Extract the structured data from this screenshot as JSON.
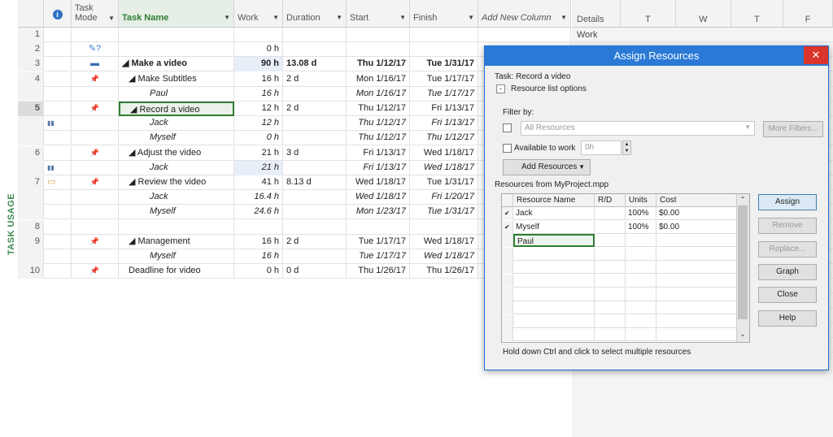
{
  "side_label": "TASK USAGE",
  "columns": {
    "info_icon": "i",
    "task_mode": "Task Mode",
    "task_name": "Task Name",
    "work": "Work",
    "duration": "Duration",
    "start": "Start",
    "finish": "Finish",
    "add_new": "Add New Column"
  },
  "rows": [
    {
      "num": "1",
      "mode": "",
      "name": "",
      "work": "",
      "duration": "",
      "start": "",
      "finish": ""
    },
    {
      "num": "2",
      "mode": "?",
      "name": "",
      "work": "0 h",
      "duration": "",
      "start": "",
      "finish": ""
    },
    {
      "num": "3",
      "mode": "summary",
      "name": "◢ Make a video",
      "work": "90 h",
      "duration": "13.08 d",
      "start": "Thu 1/12/17",
      "finish": "Tue 1/31/17"
    },
    {
      "num": "4",
      "mode": "pin",
      "name": "◢ Make Subtitles",
      "work": "16 h",
      "duration": "2 d",
      "start": "Mon 1/16/17",
      "finish": "Tue 1/17/17"
    },
    {
      "num": "",
      "mode": "",
      "name": "Paul",
      "work": "16 h",
      "duration": "",
      "start": "Mon 1/16/17",
      "finish": "Tue 1/17/17"
    },
    {
      "num": "5",
      "mode": "pin",
      "name": "◢ Record a video",
      "work": "12 h",
      "duration": "2 d",
      "start": "Thu 1/12/17",
      "finish": "Fri 1/13/17"
    },
    {
      "num": "",
      "mode": "",
      "name": "Jack",
      "work": "12 h",
      "duration": "",
      "start": "Thu 1/12/17",
      "finish": "Fri 1/13/17"
    },
    {
      "num": "",
      "mode": "",
      "name": "Myself",
      "work": "0 h",
      "duration": "",
      "start": "Thu 1/12/17",
      "finish": "Thu 1/12/17"
    },
    {
      "num": "6",
      "mode": "pin",
      "name": "◢ Adjust the video",
      "work": "21 h",
      "duration": "3 d",
      "start": "Fri 1/13/17",
      "finish": "Wed 1/18/17"
    },
    {
      "num": "",
      "mode": "",
      "name": "Jack",
      "work": "21 h",
      "duration": "",
      "start": "Fri 1/13/17",
      "finish": "Wed 1/18/17"
    },
    {
      "num": "7",
      "mode": "pin",
      "name": "◢ Review the video",
      "work": "41 h",
      "duration": "8.13 d",
      "start": "Wed 1/18/17",
      "finish": "Tue 1/31/17"
    },
    {
      "num": "",
      "mode": "",
      "name": "Jack",
      "work": "16.4 h",
      "duration": "",
      "start": "Wed 1/18/17",
      "finish": "Fri 1/20/17"
    },
    {
      "num": "",
      "mode": "",
      "name": "Myself",
      "work": "24.6 h",
      "duration": "",
      "start": "Mon 1/23/17",
      "finish": "Tue 1/31/17"
    },
    {
      "num": "8",
      "mode": "",
      "name": "",
      "work": "",
      "duration": "",
      "start": "",
      "finish": ""
    },
    {
      "num": "9",
      "mode": "pin",
      "name": "◢ Management",
      "work": "16 h",
      "duration": "2 d",
      "start": "Tue 1/17/17",
      "finish": "Wed 1/18/17"
    },
    {
      "num": "",
      "mode": "",
      "name": "Myself",
      "work": "16 h",
      "duration": "",
      "start": "Tue 1/17/17",
      "finish": "Wed 1/18/17"
    },
    {
      "num": "10",
      "mode": "pin",
      "name": "Deadline for video",
      "work": "0 h",
      "duration": "0 d",
      "start": "Thu 1/26/17",
      "finish": "Thu 1/26/17"
    }
  ],
  "timescale": {
    "details": "Details",
    "days": [
      "T",
      "W",
      "T",
      "F"
    ],
    "work_label": "Work"
  },
  "dialog": {
    "title": "Assign Resources",
    "close": "✕",
    "task_line": "Task: Record a video",
    "collapse": "-",
    "resource_list_options": "Resource list options",
    "filter_by": "Filter by:",
    "filter_value": "All Resources",
    "more_filters": "More Filters...",
    "available_to_work": "Available to work",
    "available_value": "0h",
    "add_resources": "Add Resources",
    "resources_from": "Resources from MyProject.mpp",
    "table_headers": [
      "Resource Name",
      "R/D",
      "Units",
      "Cost"
    ],
    "resources": [
      {
        "check": "✔",
        "name": "Jack",
        "rd": "",
        "units": "100%",
        "cost": "$0.00"
      },
      {
        "check": "✔",
        "name": "Myself",
        "rd": "",
        "units": "100%",
        "cost": "$0.00"
      },
      {
        "check": "",
        "name": "Paul",
        "rd": "",
        "units": "",
        "cost": ""
      }
    ],
    "buttons": {
      "assign": "Assign",
      "remove": "Remove",
      "replace": "Replace...",
      "graph": "Graph",
      "close": "Close",
      "help": "Help"
    },
    "hint": "Hold down Ctrl and click to select multiple resources"
  }
}
